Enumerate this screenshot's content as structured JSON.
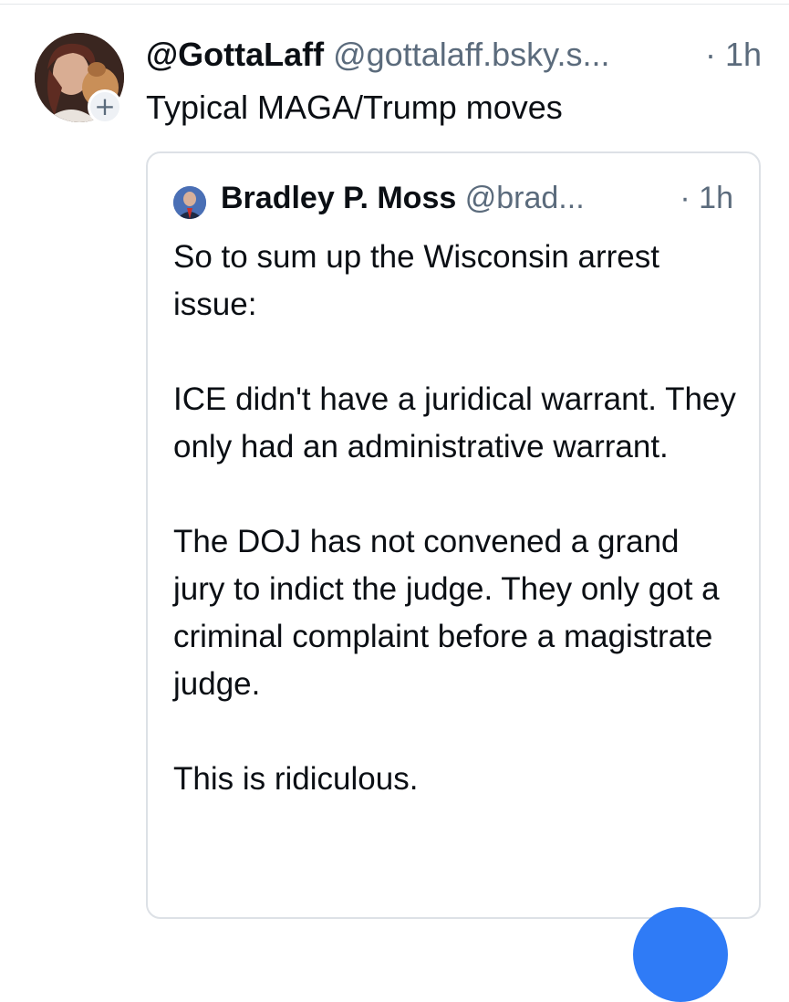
{
  "post": {
    "display_name": "@GottaLaff",
    "handle": "@gottalaff.bsky.s...",
    "timestamp": "· 1h",
    "text": "Typical MAGA/Trump moves",
    "follow_badge": "+"
  },
  "quote": {
    "display_name": "Bradley P. Moss",
    "handle": "@brad...",
    "timestamp": "· 1h",
    "paragraphs": [
      "So to sum up the Wisconsin arrest issue:",
      "ICE didn't have a juridical warrant. They only had an administrative warrant.",
      "The DOJ has not convened a grand jury to indict the judge. They only got a criminal complaint before a magistrate judge.",
      "This is ridiculous."
    ]
  },
  "icons": {
    "avatar": "profile-photo",
    "follow": "plus-icon",
    "quote_avatar": "profile-photo",
    "fab": "compose-button"
  },
  "colors": {
    "accent": "#2f7bf6",
    "muted_text": "#5b6b7c",
    "border": "#dde1e6"
  }
}
